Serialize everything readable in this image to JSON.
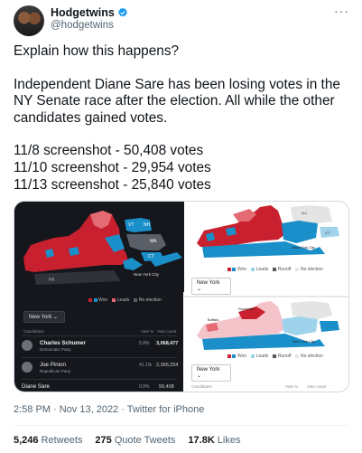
{
  "user": {
    "display_name": "Hodgetwins",
    "handle": "@hodgetwins",
    "verified": true
  },
  "icons": {
    "verified": "verified-badge-icon",
    "more": "more-icon"
  },
  "tweet": {
    "paragraphs": [
      "Explain how this happens?",
      "Independent Diane Sare has been losing votes in the NY Senate race after the election. All while the other candidates gained votes.",
      "11/8 screenshot - 50,408 votes\n11/10 screenshot - 29,954 votes\n11/13 screenshot - 25,840 votes"
    ]
  },
  "media": {
    "left": {
      "legend": {
        "won": "Won",
        "leads": "Leads",
        "no_election": "No election"
      },
      "select": "New York",
      "table_header": {
        "candidates": "Candidates",
        "vote_pct": "Vote %",
        "vote_count": "Vote count"
      },
      "rows": [
        {
          "name": "Charles Schumer",
          "party": "Democratic Party",
          "pct": "5.9%",
          "votes": "3,068,477"
        },
        {
          "name": "Joe Pinion",
          "party": "Republican Party",
          "pct": "41.1%",
          "votes": "2,366,254"
        },
        {
          "name": "Diane Sare",
          "party": "",
          "pct": "0.9%",
          "votes": "50,408"
        }
      ]
    },
    "top_right": {
      "legend": {
        "won": "Won",
        "leads": "Leads",
        "runoff": "Runoff",
        "no_election": "No election"
      },
      "select": "New York"
    },
    "bottom_right": {
      "legend": {
        "won": "Won",
        "leads": "Leads",
        "runoff": "Runoff",
        "no_election": "No election"
      },
      "select": "New York",
      "table_header": {
        "candidates": "Candidates",
        "vote_pct": "Vote %",
        "vote_count": "Vote count"
      }
    },
    "map_labels": [
      "VT",
      "NH",
      "MA",
      "CT",
      "RI",
      "New York City",
      "PA",
      "NJ",
      "Rochester",
      "Buffalo"
    ],
    "colors": {
      "dem": "#1a8fc9",
      "rep": "#c8202e",
      "dem_light": "#9fd3ec",
      "rep_light": "#f0a0a8",
      "no_election": "#e4e4e4",
      "dark_bg": "#15171c"
    }
  },
  "meta": {
    "time_date": "2:58 PM · Nov 13, 2022 · Twitter for iPhone"
  },
  "stats": {
    "retweets_count": "5,246",
    "retweets_label": "Retweets",
    "quotes_count": "275",
    "quotes_label": "Quote Tweets",
    "likes_count": "17.8K",
    "likes_label": "Likes"
  }
}
